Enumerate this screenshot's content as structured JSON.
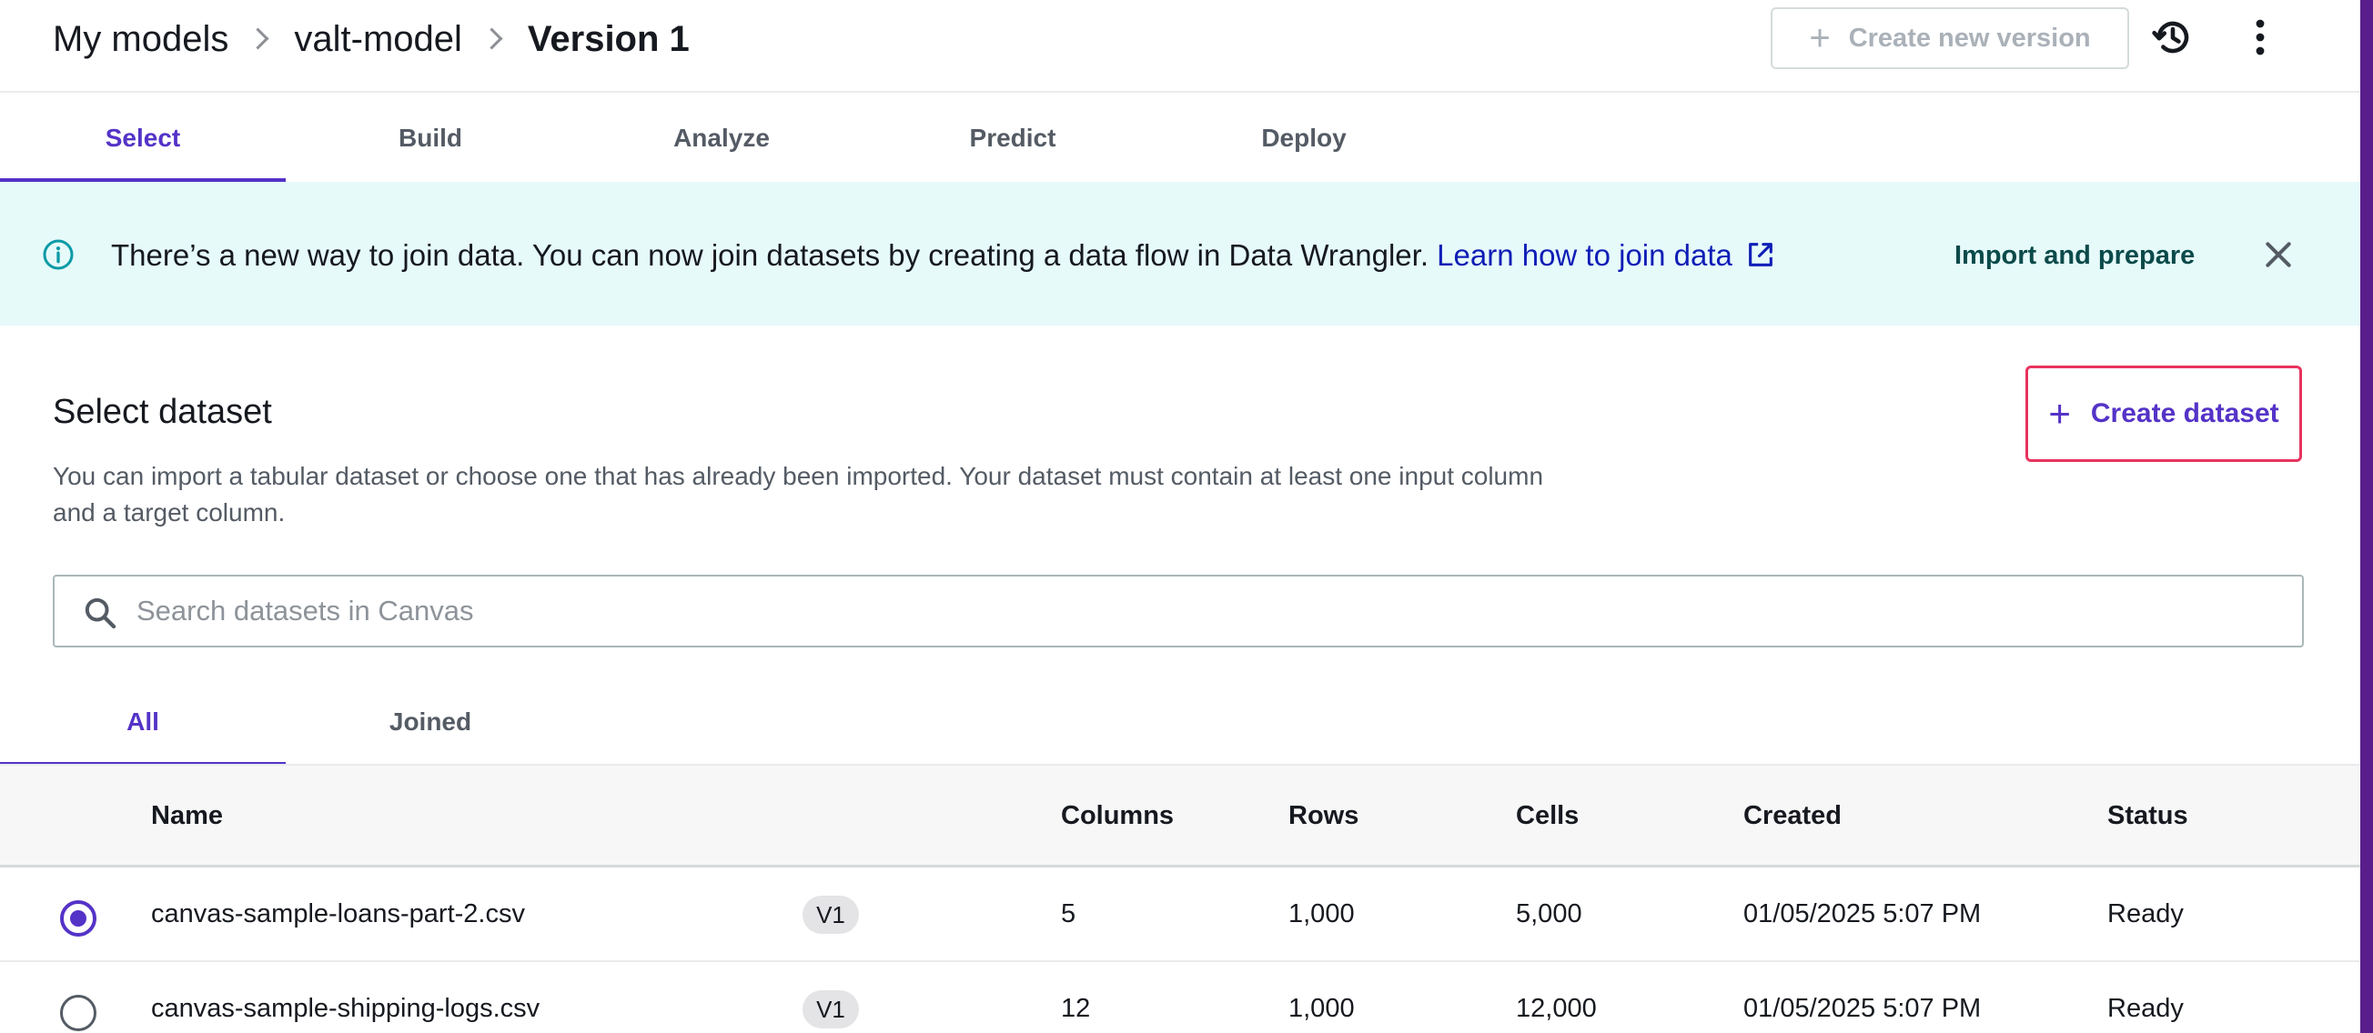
{
  "breadcrumb": {
    "items": [
      "My models",
      "valt-model"
    ],
    "current": "Version 1"
  },
  "header": {
    "create_version_label": "Create new version"
  },
  "stage_tabs": [
    "Select",
    "Build",
    "Analyze",
    "Predict",
    "Deploy"
  ],
  "banner": {
    "text": "There’s a new way to join data. You can now join datasets by creating a data flow in Data Wrangler. ",
    "link": "Learn how to join data",
    "action": "Import and prepare"
  },
  "section": {
    "title": "Select dataset",
    "description": "You can import a tabular dataset or choose one that has already been imported. Your dataset must contain at least one input column and a target column.",
    "create_dataset_label": "Create dataset"
  },
  "search": {
    "placeholder": "Search datasets in Canvas",
    "value": ""
  },
  "dataset_tabs": [
    "All",
    "Joined"
  ],
  "table": {
    "headers": [
      "Name",
      "Columns",
      "Rows",
      "Cells",
      "Created",
      "Status"
    ],
    "rows": [
      {
        "selected": true,
        "name": "canvas-sample-loans-part-2.csv",
        "version": "V1",
        "columns": "5",
        "rows": "1,000",
        "cells": "5,000",
        "created": "01/05/2025 5:07 PM",
        "status": "Ready"
      },
      {
        "selected": false,
        "name": "canvas-sample-shipping-logs.csv",
        "version": "V1",
        "columns": "12",
        "rows": "1,000",
        "cells": "12,000",
        "created": "01/05/2025 5:07 PM",
        "status": "Ready"
      }
    ]
  },
  "colors": {
    "accent": "#5433c7",
    "banner_bg": "#e6fafa",
    "link": "#0f1eb6",
    "highlight_border": "#e8335e",
    "edge_bar": "#5a1e8c"
  }
}
